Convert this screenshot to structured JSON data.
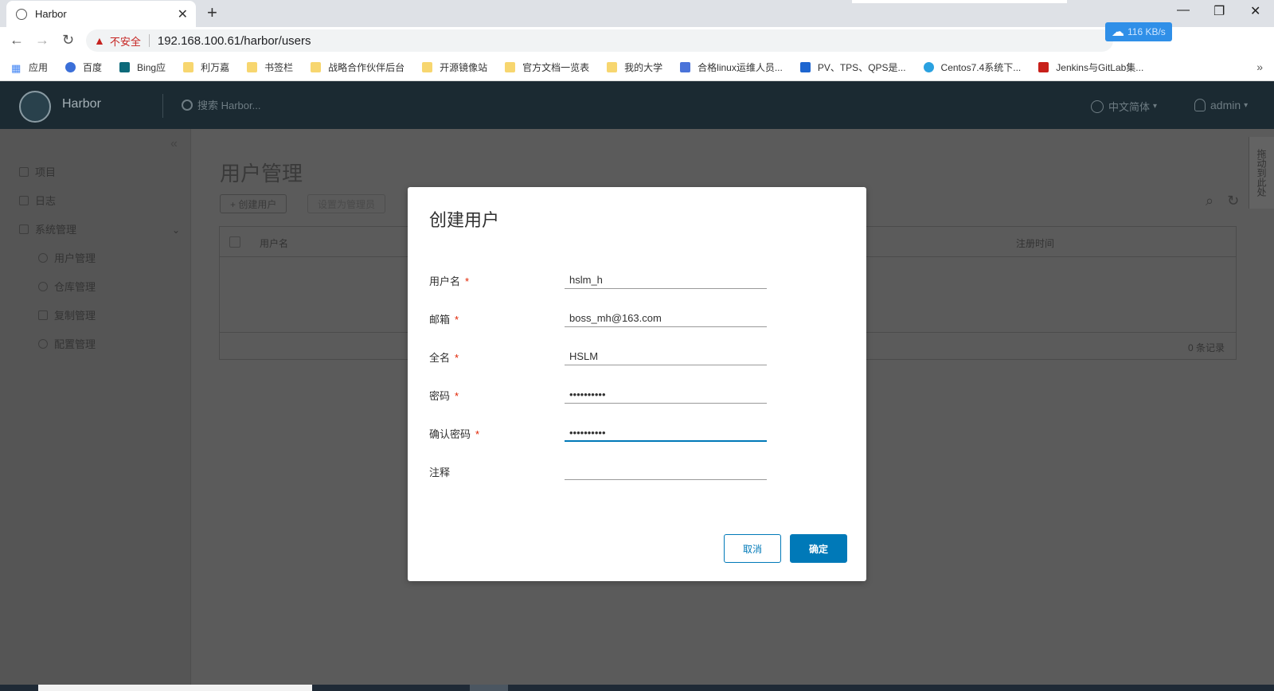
{
  "browser": {
    "tab_title": "Harbor",
    "insecure_label": "不安全",
    "url": "192.168.100.61/harbor/users",
    "download_speed": "116 KB/s",
    "bookmarks": [
      {
        "label": "应用",
        "icon": "apps-grid-icon"
      },
      {
        "label": "百度",
        "icon": "baidu-icon"
      },
      {
        "label": "Bing应",
        "icon": "bing-icon"
      },
      {
        "label": "利万嘉",
        "icon": "folder-icon"
      },
      {
        "label": "书签栏",
        "icon": "folder-icon"
      },
      {
        "label": "战略合作伙伴后台",
        "icon": "folder-icon"
      },
      {
        "label": "开源镜像站",
        "icon": "folder-icon"
      },
      {
        "label": "官方文档一览表",
        "icon": "folder-icon"
      },
      {
        "label": "我的大学",
        "icon": "folder-icon"
      },
      {
        "label": "合格linux运维人员...",
        "icon": "page-icon"
      },
      {
        "label": "PV、TPS、QPS是...",
        "icon": "zhihu-icon"
      },
      {
        "label": "Centos7.4系统下...",
        "icon": "globe-icon"
      },
      {
        "label": "Jenkins与GitLab集...",
        "icon": "c-icon"
      }
    ]
  },
  "header": {
    "brand": "Harbor",
    "search_placeholder": "搜索 Harbor...",
    "language": "中文简体",
    "user": "admin"
  },
  "sidebar": {
    "items": [
      {
        "label": "项目"
      },
      {
        "label": "日志"
      },
      {
        "label": "系统管理"
      }
    ],
    "sub_items": [
      {
        "label": "用户管理"
      },
      {
        "label": "仓库管理"
      },
      {
        "label": "复制管理"
      },
      {
        "label": "配置管理"
      }
    ]
  },
  "main": {
    "title": "用户管理",
    "create_user_label": "+ 创建用户",
    "set_admin_label": "设置为管理员",
    "columns": {
      "username": "用户名",
      "register_time": "注册时间"
    },
    "record_count": "0 条记录"
  },
  "side_tab": "拖动到此处",
  "modal": {
    "title": "创建用户",
    "fields": {
      "username": {
        "label": "用户名",
        "value": "hslm_h",
        "required": true
      },
      "email": {
        "label": "邮箱",
        "value": "boss_mh@163.com",
        "required": true
      },
      "fullname": {
        "label": "全名",
        "value": "HSLM",
        "required": true
      },
      "password": {
        "label": "密码",
        "value": "password12",
        "required": true
      },
      "confirm_password": {
        "label": "确认密码",
        "value": "password12",
        "required": true
      },
      "comment": {
        "label": "注释",
        "value": "",
        "required": false
      }
    },
    "required_mark": "*",
    "cancel_label": "取消",
    "ok_label": "确定"
  },
  "colors": {
    "accent": "#0079b8",
    "required": "#e12200",
    "header_bg": "#1b2a32"
  }
}
